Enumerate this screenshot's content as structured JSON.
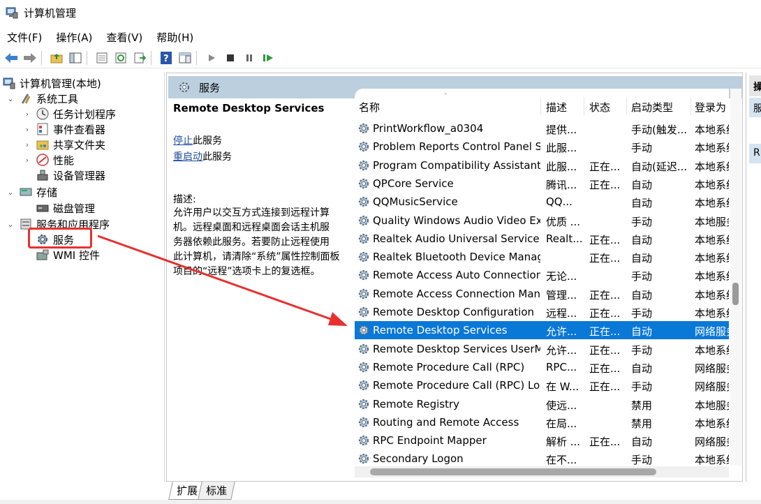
{
  "window": {
    "title": "计算机管理"
  },
  "menu": [
    "文件(F)",
    "操作(A)",
    "查看(V)",
    "帮助(H)"
  ],
  "tree": {
    "root": "计算机管理(本地)",
    "system_tools": "系统工具",
    "task_scheduler": "任务计划程序",
    "event_viewer": "事件查看器",
    "shared_folders": "共享文件夹",
    "performance": "性能",
    "device_manager": "设备管理器",
    "storage": "存储",
    "disk_management": "磁盘管理",
    "services_apps": "服务和应用程序",
    "services": "服务",
    "wmi": "WMI 控件"
  },
  "content_header": "服务",
  "desc_pane": {
    "title": "Remote Desktop Services",
    "stop_link": "停止",
    "stop_suffix": "此服务",
    "restart_link": "重启动",
    "restart_suffix": "此服务",
    "desc_label": "描述:",
    "desc_lines": [
      "允许用户以交互方式连接到远程计算",
      "机。远程桌面和远程桌面会话主机服",
      "务器依赖此服务。若要防止远程使用",
      "此计算机，请清除“系统”属性控制面板",
      "项目的“远程”选项卡上的复选框。"
    ]
  },
  "table": {
    "columns": {
      "name": "名称",
      "desc": "描述",
      "status": "状态",
      "startup": "启动类型",
      "logon": "登录为"
    },
    "rows": [
      {
        "name": "PrintWorkflow_a0304",
        "desc": "提供...",
        "status": "",
        "startup": "手动(触发...",
        "logon": "本地系统"
      },
      {
        "name": "Problem Reports Control Panel S...",
        "desc": "此服...",
        "status": "",
        "startup": "手动",
        "logon": "本地系统"
      },
      {
        "name": "Program Compatibility Assistant S...",
        "desc": "此服...",
        "status": "正在...",
        "startup": "自动(延迟...",
        "logon": "本地系统"
      },
      {
        "name": "QPCore Service",
        "desc": "腾讯...",
        "status": "正在...",
        "startup": "自动",
        "logon": "本地系统"
      },
      {
        "name": "QQMusicService",
        "desc": "QQ...",
        "status": "",
        "startup": "自动",
        "logon": "本地系统"
      },
      {
        "name": "Quality Windows Audio Video Ex...",
        "desc": "优质 ...",
        "status": "",
        "startup": "手动",
        "logon": "本地服务"
      },
      {
        "name": "Realtek Audio Universal Service",
        "desc": "Realt...",
        "status": "正在...",
        "startup": "自动",
        "logon": "本地系统"
      },
      {
        "name": "Realtek Bluetooth Device Manag...",
        "desc": "",
        "status": "正在...",
        "startup": "自动",
        "logon": "本地系统"
      },
      {
        "name": "Remote Access Auto Connection...",
        "desc": "无论...",
        "status": "",
        "startup": "手动",
        "logon": "本地系统"
      },
      {
        "name": "Remote Access Connection Man...",
        "desc": "管理...",
        "status": "正在...",
        "startup": "自动",
        "logon": "本地系统"
      },
      {
        "name": "Remote Desktop Configuration",
        "desc": "远程...",
        "status": "正在...",
        "startup": "手动",
        "logon": "本地系统"
      },
      {
        "name": "Remote Desktop Services",
        "desc": "允许...",
        "status": "正在...",
        "startup": "自动",
        "logon": "网络服务"
      },
      {
        "name": "Remote Desktop Services UserM...",
        "desc": "允许...",
        "status": "正在...",
        "startup": "手动",
        "logon": "本地系统"
      },
      {
        "name": "Remote Procedure Call (RPC)",
        "desc": "RPC...",
        "status": "正在...",
        "startup": "自动",
        "logon": "网络服务"
      },
      {
        "name": "Remote Procedure Call (RPC) Lo...",
        "desc": "在 W...",
        "status": "正在...",
        "startup": "手动",
        "logon": "网络服务"
      },
      {
        "name": "Remote Registry",
        "desc": "使远...",
        "status": "",
        "startup": "禁用",
        "logon": "本地服务"
      },
      {
        "name": "Routing and Remote Access",
        "desc": "在局...",
        "status": "",
        "startup": "禁用",
        "logon": "本地系统"
      },
      {
        "name": "RPC Endpoint Mapper",
        "desc": "解析 ...",
        "status": "正在...",
        "startup": "自动",
        "logon": "网络服务"
      },
      {
        "name": "Secondary Logon",
        "desc": "在不...",
        "status": "",
        "startup": "手动",
        "logon": "本地系统"
      }
    ],
    "selected_index": 11
  },
  "tabs": [
    "扩展",
    "标准"
  ],
  "action_pane": {
    "header": "操",
    "items": [
      "服",
      "R"
    ]
  },
  "colors": {
    "selection": "#0a78d7",
    "header_band": "#bccfdf",
    "annotation_red": "#e8302e",
    "link": "#1f4e9e"
  }
}
